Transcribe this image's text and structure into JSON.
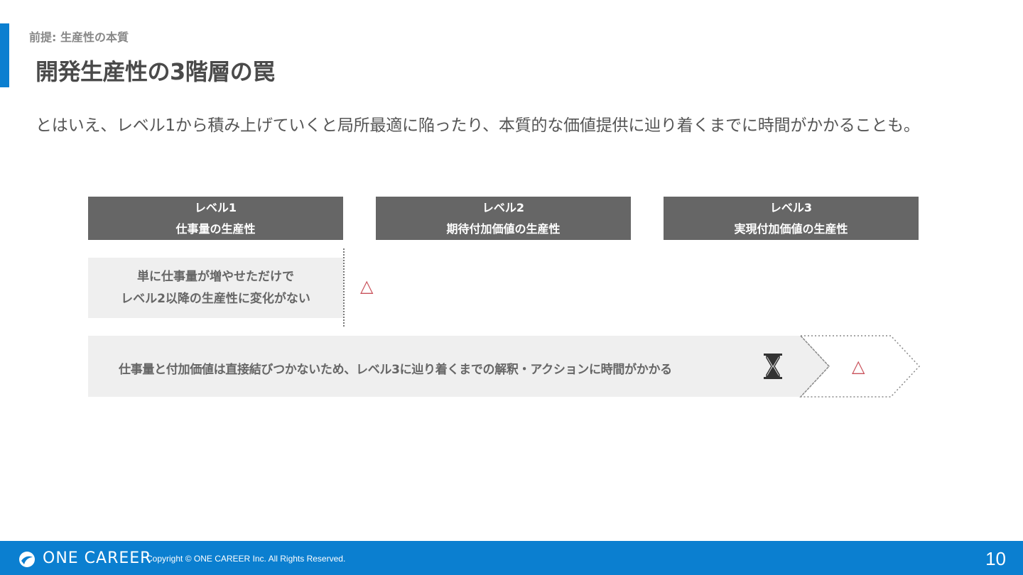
{
  "header": {
    "eyebrow": "前提: 生産性の本質",
    "title": "開発生産性の3階層の罠"
  },
  "lead": "とはいえ、レベル1から積み上げていくと局所最適に陥ったり、本質的な価値提供に辿り着くまでに時間がかかることも。",
  "levels": [
    {
      "level": "レベル1",
      "name": "仕事量の生産性"
    },
    {
      "level": "レベル2",
      "name": "期待付加価値の生産性"
    },
    {
      "level": "レベル3",
      "name": "実現付加価値の生産性"
    }
  ],
  "box1": {
    "line1": "単に仕事量が増やせただけで",
    "line2": "レベル2以降の生産性に変化がない"
  },
  "box2": {
    "text": "仕事量と付加価値は直接結びつかないため、レベル3に辿り着くまでの解釈・アクションに時間がかかる"
  },
  "marks": {
    "triangle": "△",
    "icons": [
      "triangle-warning-icon",
      "hourglass-icon"
    ],
    "warning_color": "#c9525b"
  },
  "footer": {
    "brand": "ONE CAREER",
    "copyright": "Copyright © ONE CAREER Inc. All Rights Reserved.",
    "page_number": "10"
  },
  "colors": {
    "accent": "#0b7fd0",
    "header_gray": "#666666",
    "box_gray": "#efefef"
  }
}
